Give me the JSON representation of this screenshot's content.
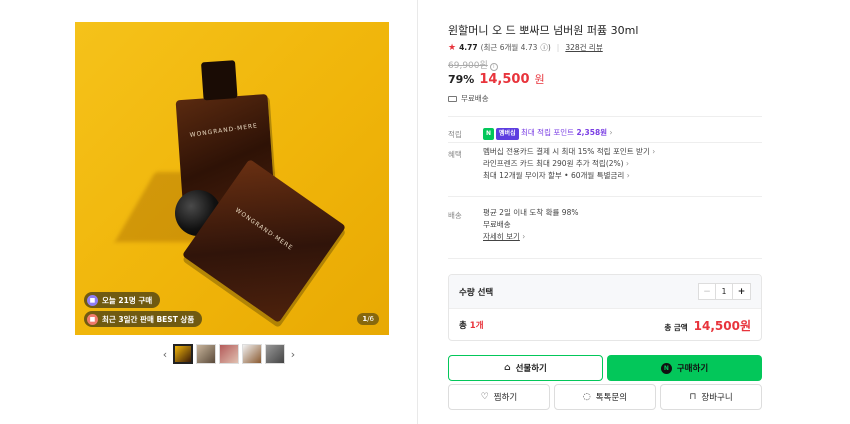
{
  "gallery": {
    "badge_today": "오늘 21명 구매",
    "badge_best": "최근 3일간 판매 BEST 상품",
    "counter_current": "1",
    "counter_total": "/6",
    "bottle_label": "WONGRAND·MERE",
    "prev_arrow": "‹",
    "next_arrow": "›"
  },
  "product": {
    "title": "윈할머니 오 드 뽀싸므 넘버원 퍼퓸 30ml",
    "rating_score": "4.77",
    "rating_recent": "(최근 6개월 4.73",
    "review_count": "328건 리뷰",
    "original_price": "69,900원",
    "discount_rate": "79%",
    "sale_price": "14,500",
    "won": "원",
    "free_shipping_badge": "무료배송"
  },
  "details": {
    "points_label": "적립",
    "points_badge": "N",
    "points_pay": "멤버십",
    "points_text": "최대 적립 포인트 ",
    "points_value": "2,358원",
    "benefit_label": "혜택",
    "benefit_line1": "멤버십 전용카드 결제 시 최대 15% 적립 포인트 받기",
    "benefit_line2": "라인프렌즈 카드 최대 290원 추가 적립(2%)",
    "benefit_line3": "최대 12개월 무이자 할부 • 60개월 특별금리",
    "delivery_label": "배송",
    "delivery_line1": "평균 2일 이내 도착 확률 98%",
    "delivery_line2": "무료배송",
    "delivery_more": "자세히 보기"
  },
  "quantity": {
    "label": "수량 선택",
    "value": "1",
    "minus": "−",
    "plus": "+",
    "total_prefix": "총 ",
    "total_count": "1개",
    "amount_label": "총 금액",
    "amount_value": "14,500원"
  },
  "buttons": {
    "gift": "선물하기",
    "buy": "구매하기",
    "wish": "찜하기",
    "talk": "톡톡문의",
    "cart": "장바구니"
  },
  "colors": {
    "accent_green": "#03c75a",
    "price_red": "#e8343c",
    "background_yellow": "#f0b50a"
  }
}
